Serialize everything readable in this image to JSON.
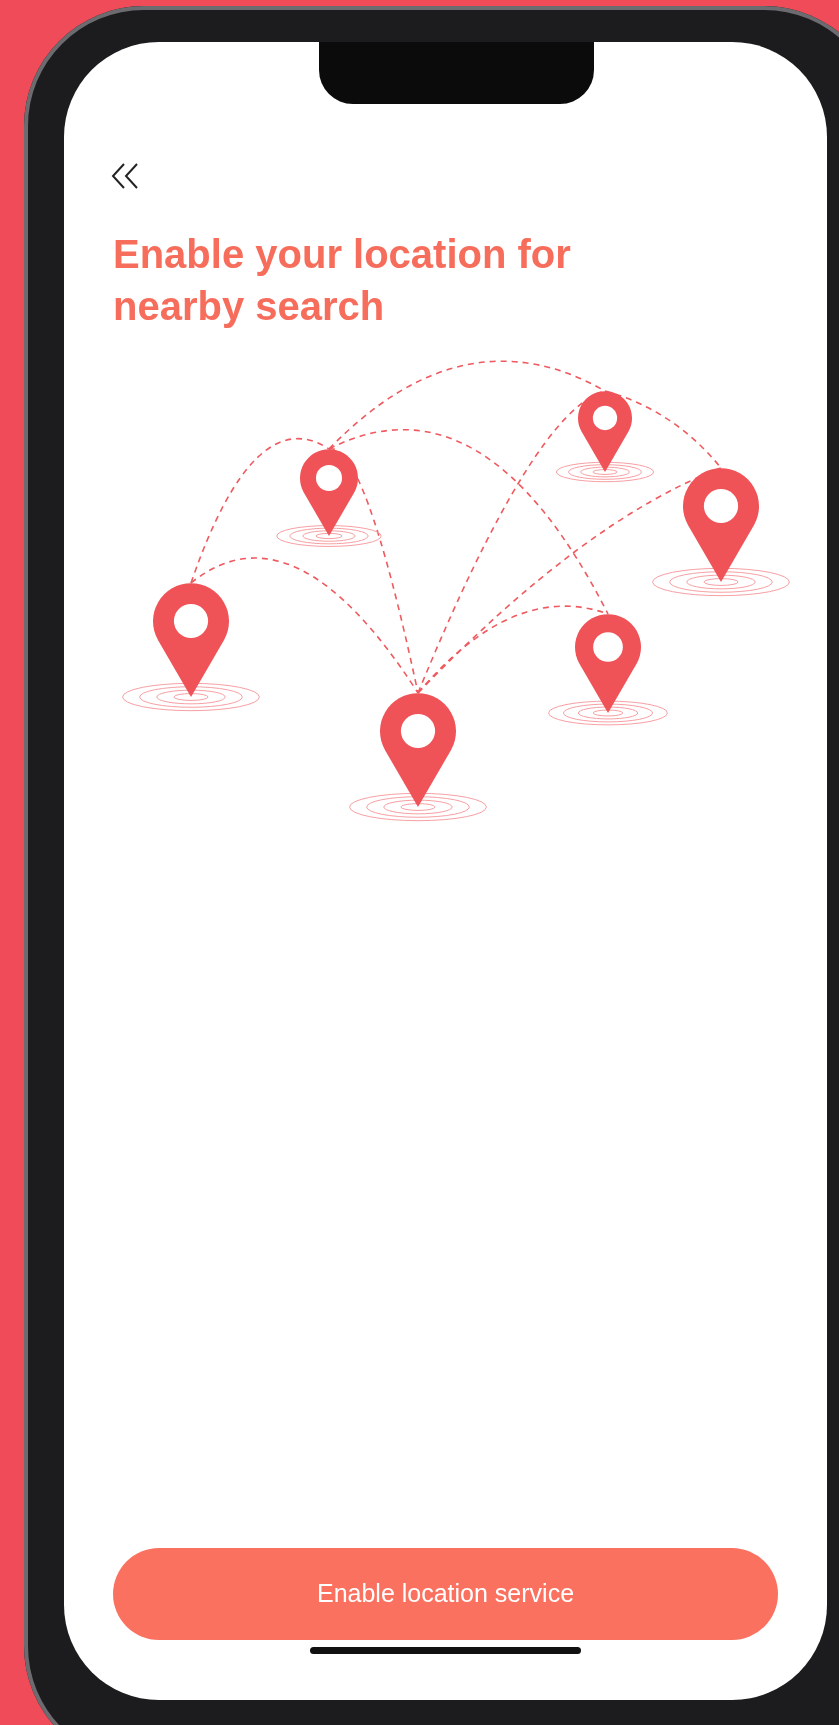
{
  "screen": {
    "title": "Enable your location for nearby search"
  },
  "button": {
    "label": "Enable location service"
  }
}
